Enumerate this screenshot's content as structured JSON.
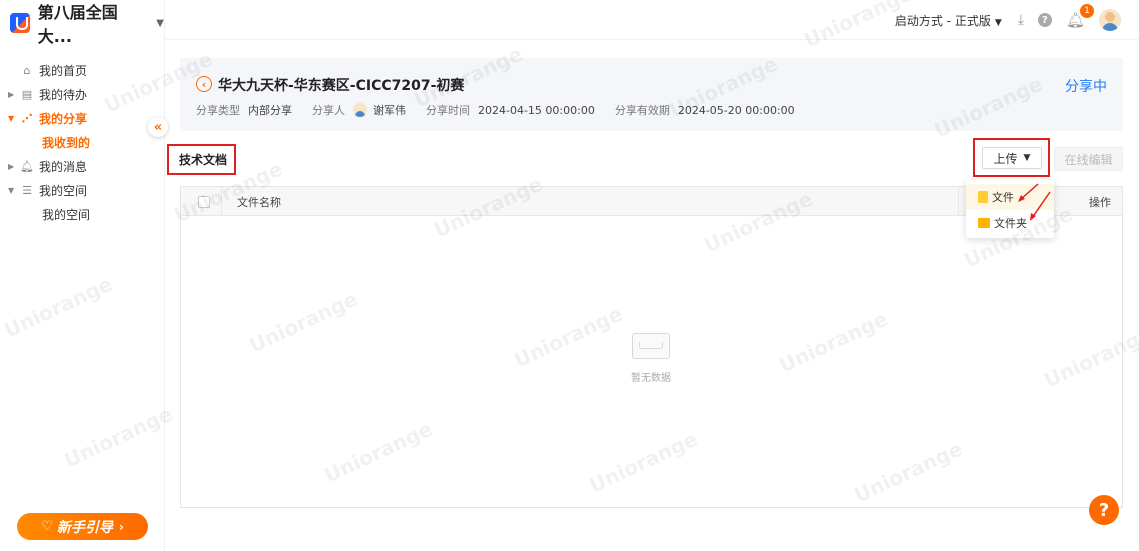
{
  "app": {
    "brand_name": "第八届全国大..."
  },
  "topbar": {
    "launch_label": "启动方式 - 正式版",
    "notification_count": "1"
  },
  "sidebar": {
    "items": [
      {
        "label": "我的首页",
        "icon": "home-icon"
      },
      {
        "label": "我的待办",
        "icon": "todo-icon"
      },
      {
        "label": "我的分享",
        "icon": "share-icon"
      },
      {
        "label": "我收到的"
      },
      {
        "label": "我的消息",
        "icon": "bell-icon"
      },
      {
        "label": "我的空间",
        "icon": "space-icon"
      },
      {
        "label": "我的空间"
      }
    ],
    "guide_label": "新手引导"
  },
  "share": {
    "title": "华大九天杯-华东赛区-CICC7207-初赛",
    "status": "分享中",
    "type_label": "分享类型",
    "type_value": "内部分享",
    "sharer_label": "分享人",
    "sharer_value": "谢军伟",
    "time_label": "分享时间",
    "time_value": "2024-04-15 00:00:00",
    "expire_label": "分享有效期",
    "expire_value": "2024-05-20 00:00:00"
  },
  "section": {
    "title": "技术文档",
    "upload_label": "上传",
    "edit_label": "在线编辑"
  },
  "table": {
    "col_name": "文件名称",
    "col_op": "操作",
    "empty_text": "暂无数据"
  },
  "dropdown": {
    "items": [
      "文件",
      "文件夹"
    ]
  },
  "watermark": "Uniorange",
  "colors": {
    "accent": "#ff6a00",
    "link": "#1f7bff",
    "highlight_border": "#e02020"
  }
}
